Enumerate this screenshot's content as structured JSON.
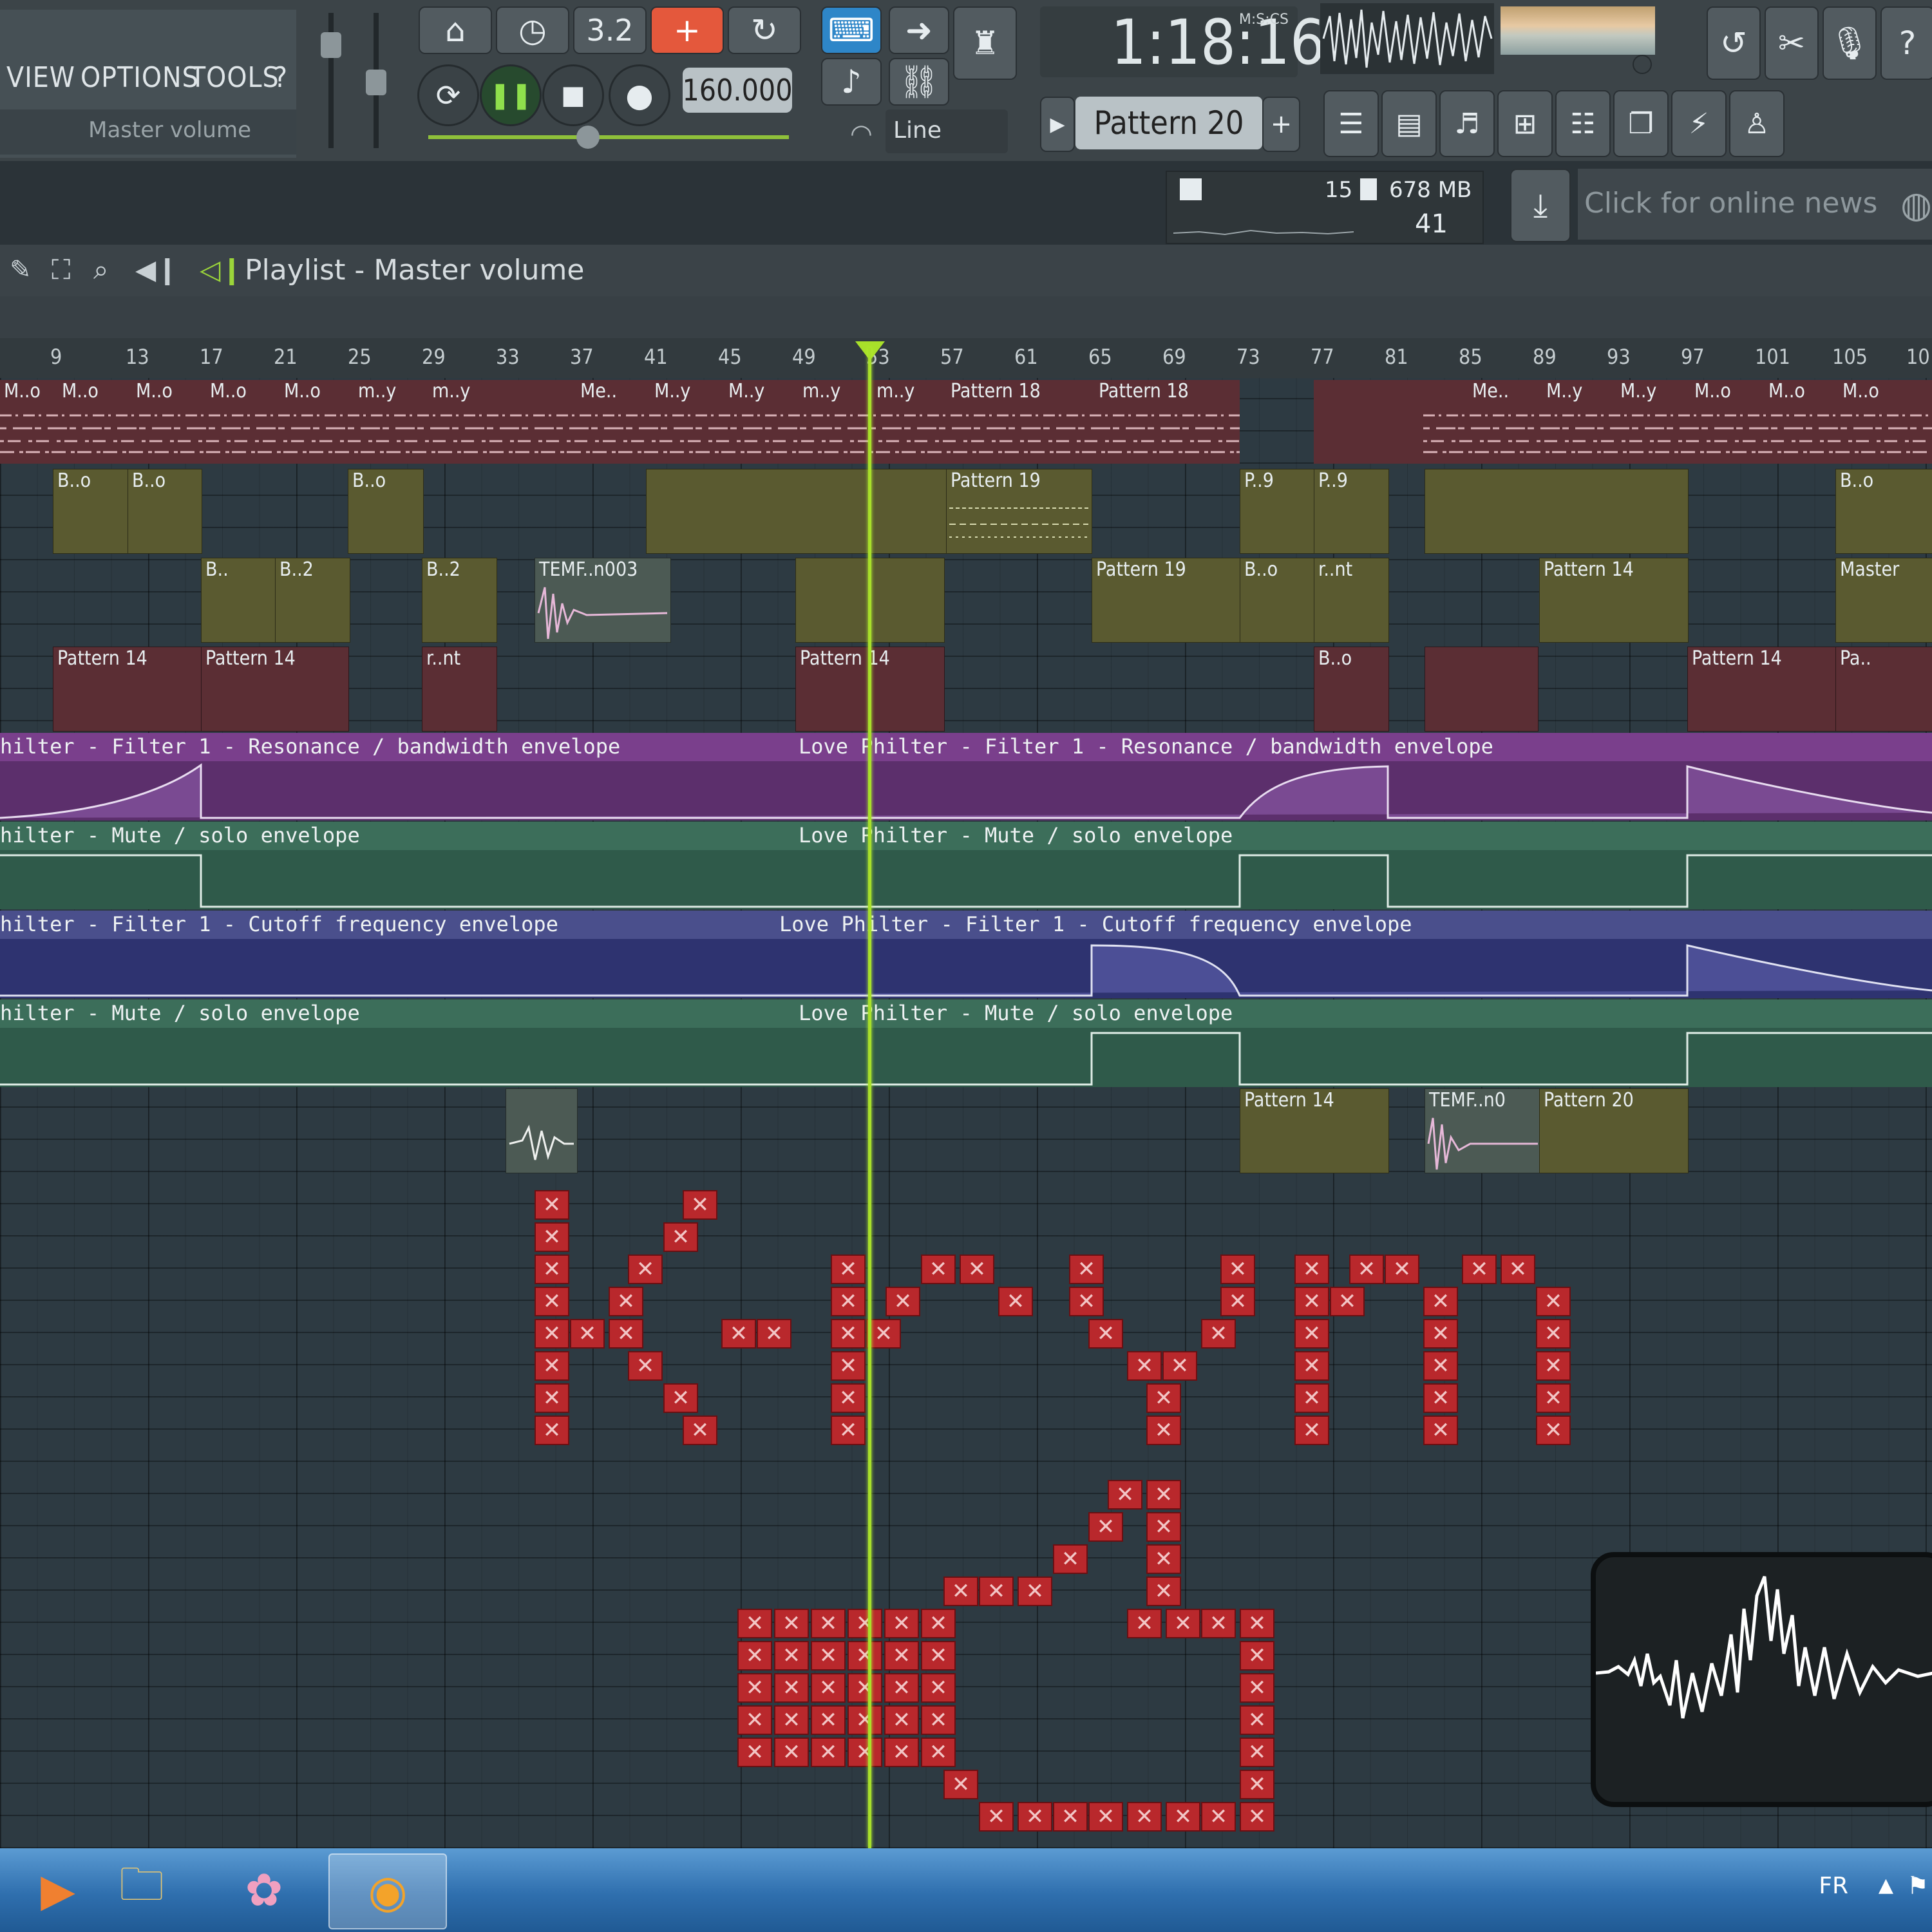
{
  "menu": {
    "items": [
      "VIEW",
      "OPTIONS",
      "TOOLS",
      "?"
    ],
    "hint": "Master volume"
  },
  "transport": {
    "tempo": "160.000",
    "time": "1:18:16",
    "time_unit": "M:S:CS",
    "snap": "Line",
    "pattern": "Pattern 20",
    "buttons": [
      "3.2"
    ]
  },
  "system": {
    "cpu": "15",
    "memory": "678 MB",
    "polyphony": "41"
  },
  "news": "Click for online news",
  "playlist": {
    "title": "Playlist - Master volume"
  },
  "ruler": [
    "9",
    "13",
    "17",
    "21",
    "25",
    "29",
    "33",
    "37",
    "41",
    "45",
    "49",
    "53",
    "57",
    "61",
    "65",
    "69",
    "73",
    "77",
    "81",
    "85",
    "89",
    "93",
    "97",
    "101",
    "105",
    "10"
  ],
  "clips": {
    "row1": [
      "M..o",
      "M..o",
      "M..o",
      "M..o",
      "M..o",
      "m..y",
      "m..y",
      "Me..",
      "M..y",
      "M..y",
      "m..y",
      "m..y",
      "Pattern 18",
      "Pattern 18",
      "Me..",
      "M..y",
      "M..y",
      "M..o",
      "M..o",
      "M..o"
    ],
    "row2": [
      "B..o",
      "B..o",
      "B..o",
      "Pattern 19",
      "P..9",
      "P..9",
      "B..o"
    ],
    "row3": [
      "B..",
      "B..2",
      "B..2",
      "TEMF..n003",
      "Pattern 19",
      "B..o",
      "r..nt",
      "Pattern 14",
      "Master"
    ],
    "row4": [
      "Pattern 14",
      "Pattern 14",
      "r..nt",
      "Pattern 14",
      "B..o",
      "Pattern 14",
      "Pa.."
    ],
    "row9": [
      "Pattern 14",
      "TEMF..n0",
      "Pattern 20"
    ]
  },
  "envelopes": [
    {
      "left": "hilter - Filter 1 - Resonance / bandwidth envelope",
      "right": "Love Philter - Filter 1 - Resonance / bandwidth envelope",
      "color": "#7a3f8c"
    },
    {
      "left": "hilter - Mute / solo envelope",
      "right": "Love Philter - Mute / solo envelope",
      "color": "#3c6e5a"
    },
    {
      "left": "hilter - Filter 1 - Cutoff frequency envelope",
      "right": "Love Philter - Filter 1 - Cutoff frequency envelope",
      "color": "#4a4f8c"
    },
    {
      "left": "hilter - Mute / solo envelope",
      "right": "Love Philter - Mute / solo envelope",
      "color": "#3c6e5a"
    }
  ],
  "taskbar": {
    "language": "FR"
  },
  "colors": {
    "accent": "#a8e02a",
    "xcell": "#b9282c",
    "toolbar": "#3c4448"
  }
}
